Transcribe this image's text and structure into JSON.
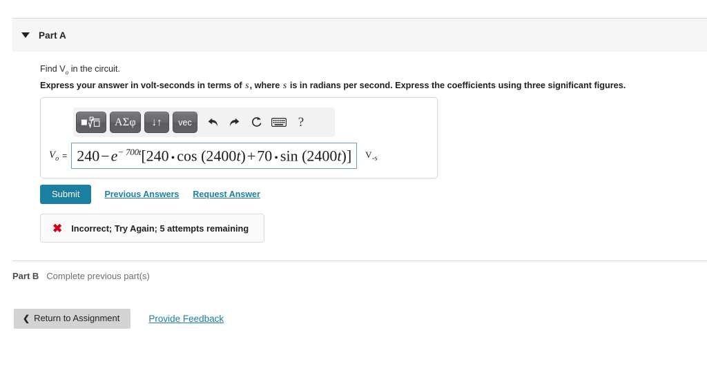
{
  "part_a": {
    "title": "Part A",
    "caret_icon": "chevron-down-icon",
    "question": "Find V",
    "question_sub": "o",
    "question_tail": " in the circuit.",
    "instruction_1": "Express your answer in volt-seconds in terms of ",
    "instruction_var1": "s",
    "instruction_2": ", where ",
    "instruction_var2": "s",
    "instruction_3": " is in radians per second. Express the coefficients using three significant figures."
  },
  "math_toolbar": {
    "buttons": [
      {
        "name": "template-sqrt-button",
        "label": "",
        "icon": "square-nth-root-icon"
      },
      {
        "name": "greek-symbols-button",
        "label": "ΑΣφ",
        "icon": "greek-letters-icon"
      },
      {
        "name": "arrows-button",
        "label": "↓↑",
        "icon": "up-down-arrows-icon"
      },
      {
        "name": "vector-button",
        "label": "vec",
        "icon": "vector-icon"
      }
    ],
    "icons": [
      {
        "name": "undo-icon",
        "glyph": "undo"
      },
      {
        "name": "redo-icon",
        "glyph": "redo"
      },
      {
        "name": "reset-icon",
        "glyph": "refresh"
      },
      {
        "name": "keyboard-icon",
        "glyph": "keyboard"
      },
      {
        "name": "help-icon",
        "glyph": "?"
      }
    ],
    "help_label": "?"
  },
  "answer": {
    "label": "V",
    "label_sub": "o",
    "equals": "=",
    "expression_plain": "240 − e^(−700t)[240 • cos (2400t) + 70 • sin (2400t)]",
    "parts": {
      "lead": "240",
      "minus": "−",
      "e": "e",
      "exponent": "− 700t",
      "bracket_open": "[",
      "coef1": "240",
      "dot1": "•",
      "fn1": "cos (2400",
      "fn1_var": "t",
      "fn1_close": ")",
      "plus": "+",
      "coef2": "70",
      "dot2": "•",
      "fn2": "sin (2400",
      "fn2_var": "t",
      "fn2_close": ")",
      "bracket_close": "]"
    },
    "unit": "V",
    "unit_sub": "-s"
  },
  "actions": {
    "submit_label": "Submit",
    "previous_answers_label": "Previous Answers",
    "request_answer_label": "Request Answer"
  },
  "feedback": {
    "icon": "x-mark-icon",
    "icon_glyph": "✖",
    "message": "Incorrect; Try Again; 5 attempts remaining",
    "attempts_remaining": 5
  },
  "part_b": {
    "label": "Part B",
    "status": "Complete previous part(s)"
  },
  "footer": {
    "return_chevron": "❮",
    "return_label": "Return to Assignment",
    "provide_feedback_label": "Provide Feedback"
  },
  "colors": {
    "accent": "#1d7fa0",
    "header_bg": "#f6f6f6",
    "error": "#d6001c",
    "toolbar_button": "#6a6b6f",
    "answer_box_border": "#6d9fb3"
  }
}
